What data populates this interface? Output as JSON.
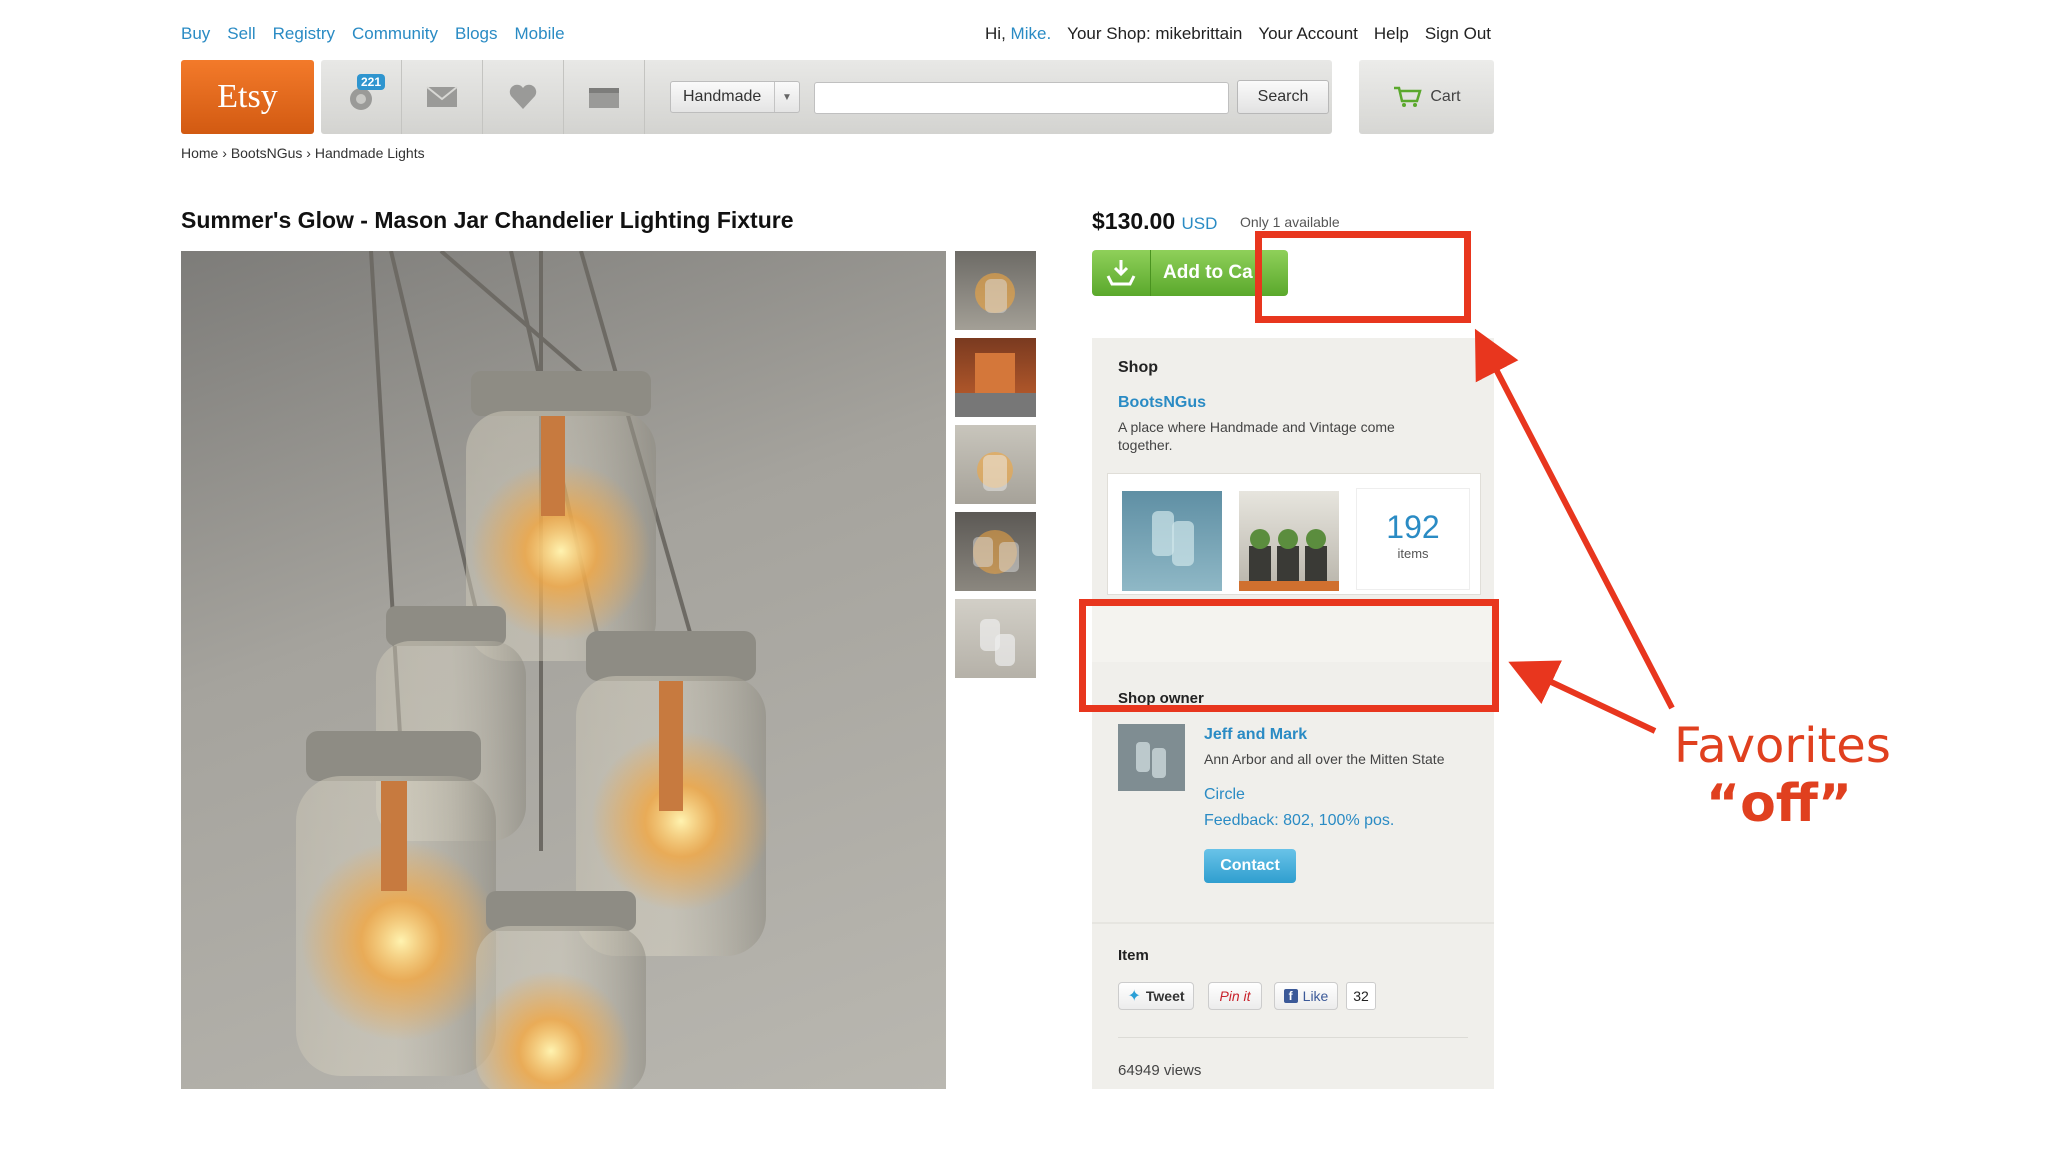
{
  "top_nav": {
    "links": [
      "Buy",
      "Sell",
      "Registry",
      "Community",
      "Blogs",
      "Mobile"
    ]
  },
  "user_nav": {
    "greeting": "Hi,",
    "user_name": "Mike.",
    "your_shop": "Your Shop: mikebrittain",
    "your_account": "Your Account",
    "help": "Help",
    "sign_out": "Sign Out"
  },
  "header": {
    "logo": "Etsy",
    "notification_count": "221",
    "search_category": "Handmade",
    "search_value": "",
    "search_button": "Search",
    "cart_label": "Cart"
  },
  "breadcrumb": {
    "items": [
      "Home",
      "BootsNGus",
      "Handmade Lights"
    ],
    "separator": "›"
  },
  "listing": {
    "title": "Summer's Glow - Mason Jar Chandelier Lighting Fixture",
    "price": "$130.00",
    "currency": "USD",
    "availability": "Only 1 available",
    "add_to_cart": "Add to Ca"
  },
  "shop": {
    "heading": "Shop",
    "name": "BootsNGus",
    "description": "A place where Handmade and Vintage come together.",
    "item_count": "192",
    "item_count_label": "items"
  },
  "shop_owner": {
    "heading": "Shop owner",
    "name": "Jeff and Mark",
    "location": "Ann Arbor and all over the Mitten State",
    "circle": "Circle",
    "feedback": "Feedback: 802, 100% pos.",
    "contact": "Contact"
  },
  "item": {
    "heading": "Item",
    "tweet": "Tweet",
    "pinit": "Pin it",
    "like": "Like",
    "like_count": "32",
    "views": "64949 views"
  },
  "annotation": {
    "line1": "Favorites",
    "line2": "“off”",
    "color": "#e8361e"
  },
  "colors": {
    "link": "#2a8bc4",
    "etsy_orange": "#e56a1f",
    "cart_green": "#6cbb3c"
  }
}
